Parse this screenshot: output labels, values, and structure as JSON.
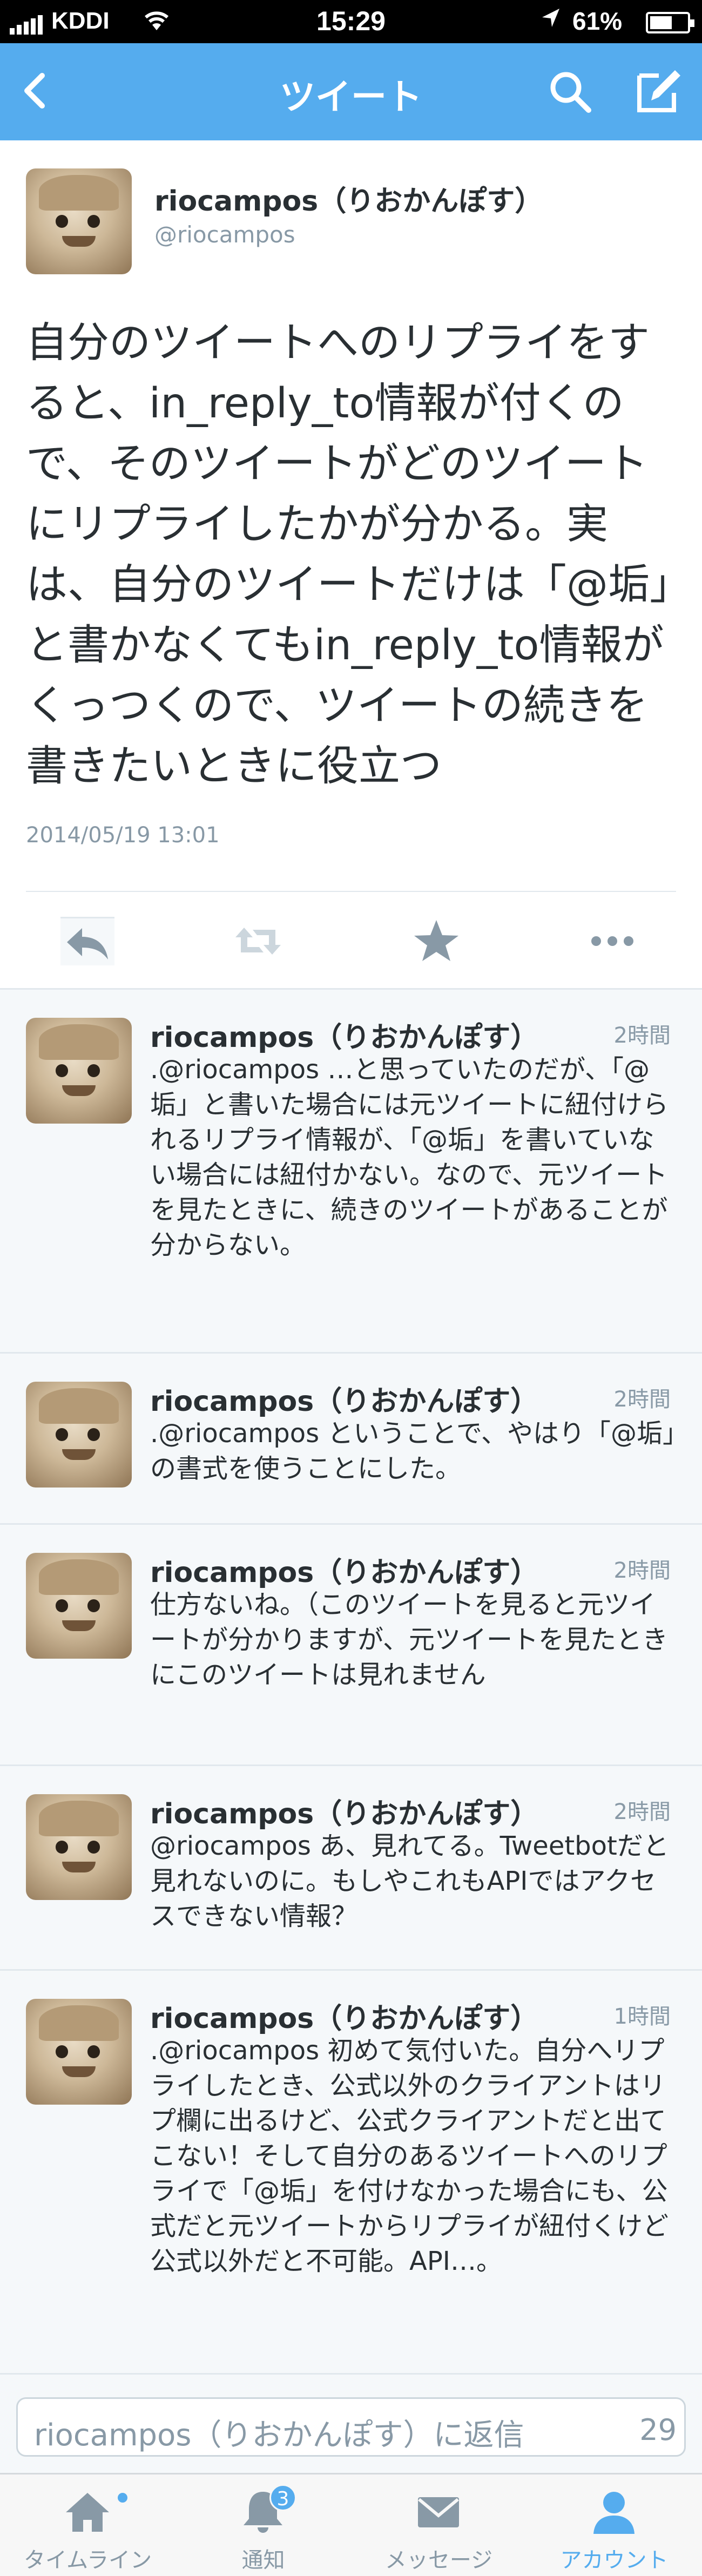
{
  "status_bar": {
    "carrier": "KDDI",
    "time": "15:29",
    "battery": "61%",
    "battery_level": 0.61
  },
  "nav": {
    "title": "ツイート",
    "back_icon": "chevron-left-icon",
    "search_icon": "search-icon",
    "compose_icon": "compose-icon"
  },
  "main_tweet": {
    "name": "riocampos（りおかんぽす）",
    "handle": "@riocampos",
    "text": "自分のツイートへのリプライをすると、in_reply_to情報が付くので、そのツイートがどのツイートにリプライしたかが分かる。実は、自分のツイートだけは「@垢」と書かなくてもin_reply_to情報がくっつくので、ツイートの続きを書きたいときに役立つ",
    "date": "2014/05/19 13:01",
    "actions": [
      "reply-icon",
      "retweet-icon",
      "star-icon",
      "more-icon"
    ]
  },
  "replies": [
    {
      "name": "riocampos（りおかんぽす）",
      "time": "2時間",
      "text": ".@riocampos …と思っていたのだが、「@垢」と書いた場合には元ツイートに紐付けられるリプライ情報が、「@垢」を書いていない場合には紐付かない。なので、元ツイートを見たときに、続きのツイートがあることが分からない。"
    },
    {
      "name": "riocampos（りおかんぽす）",
      "time": "2時間",
      "text": ".@riocampos ということで、やはり「@垢」の書式を使うことにした。"
    },
    {
      "name": "riocampos（りおかんぽす）",
      "time": "2時間",
      "text": "仕方ないね。（このツイートを見ると元ツイートが分かりますが、元ツイートを見たときにこのツイートは見れません"
    },
    {
      "name": "riocampos（りおかんぽす）",
      "time": "2時間",
      "text": "@riocampos あ、見れてる。Tweetbotだと見れないのに。もしやこれもAPIではアクセスできない情報？"
    },
    {
      "name": "riocampos（りおかんぽす）",
      "time": "1時間",
      "text": ".@riocampos 初めて気付いた。自分へリプライしたとき、公式以外のクライアントはリプ欄に出るけど、公式クライアントだと出てこない！そして自分のあるツイートへのリプライで「@垢」を付けなかった場合にも、公式だと元ツイートからリプライが紐付くけど公式以外だと不可能。API…。"
    }
  ],
  "reply_box": {
    "placeholder": "riocampos（りおかんぽす）に返信",
    "char_count": "29"
  },
  "tabs": [
    {
      "label": "タイムライン",
      "icon": "home-icon",
      "dot": true
    },
    {
      "label": "通知",
      "icon": "bell-icon",
      "badge": "3"
    },
    {
      "label": "メッセージ",
      "icon": "envelope-icon"
    },
    {
      "label": "アカウント",
      "icon": "person-icon",
      "active": true
    }
  ],
  "colors": {
    "accent": "#55acee",
    "text": "#292f33",
    "muted": "#8899a6",
    "border": "#e1e8ed"
  }
}
